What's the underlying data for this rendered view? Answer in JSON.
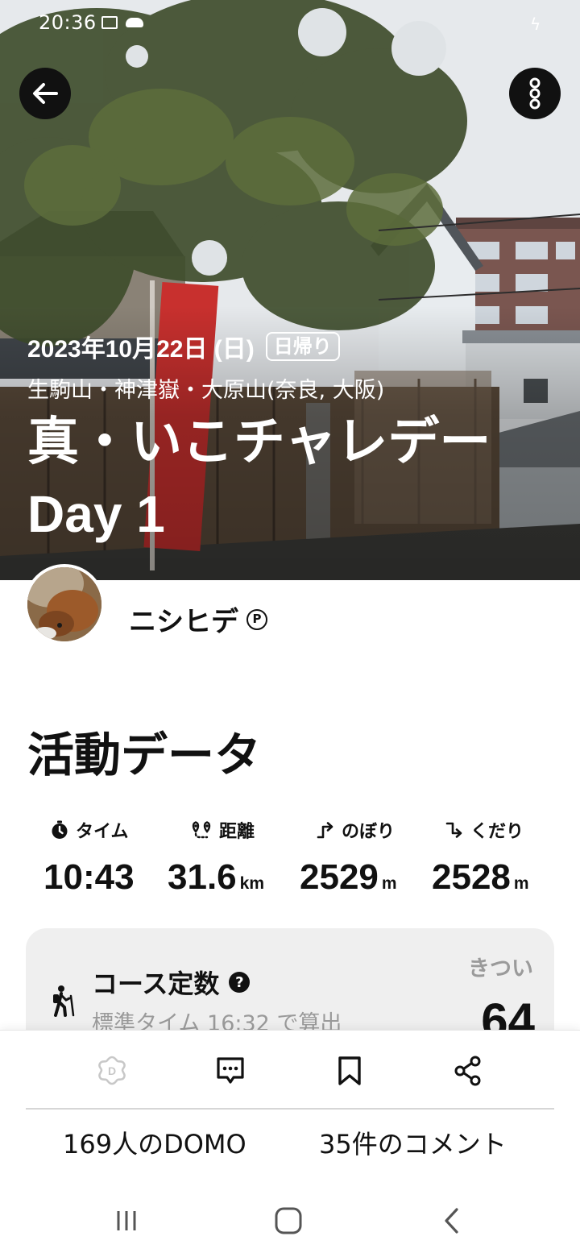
{
  "status_bar": {
    "time": "20:36"
  },
  "hero": {
    "date": "2023年10月22日 (日)",
    "trip_type": "日帰り",
    "mountains": "生駒山・神津嶽・大原山(奈良, 大阪)",
    "title": "真・いこチャレデー Day 1"
  },
  "user": {
    "name": "ニシヒデ",
    "badge": "P"
  },
  "activity": {
    "section_title": "活動データ",
    "stats": [
      {
        "icon": "stopwatch-icon",
        "label": "タイム",
        "value": "10:43",
        "unit": ""
      },
      {
        "icon": "route-pin-icon",
        "label": "距離",
        "value": "31.6",
        "unit": "km"
      },
      {
        "icon": "ascent-arrow-icon",
        "label": "のぼり",
        "value": "2529",
        "unit": "m"
      },
      {
        "icon": "descent-arrow-icon",
        "label": "くだり",
        "value": "2528",
        "unit": "m"
      }
    ],
    "course": {
      "title": "コース定数",
      "help": "?",
      "subtitle": "標準タイム 16:32 で算出",
      "level": "きつい",
      "value": "64"
    }
  },
  "actions": {
    "icons": [
      "domo-icon",
      "comment-icon",
      "bookmark-icon",
      "share-icon"
    ],
    "domo_count": "169人のDOMO",
    "comment_count": "35件のコメント"
  },
  "nav": {
    "buttons": [
      "recent-apps-icon",
      "home-icon",
      "back-nav-icon"
    ]
  },
  "colors": {
    "text": "#111111",
    "muted": "#9a9a9a",
    "card": "#efefef",
    "domo_disabled": "#c8c8c8"
  }
}
